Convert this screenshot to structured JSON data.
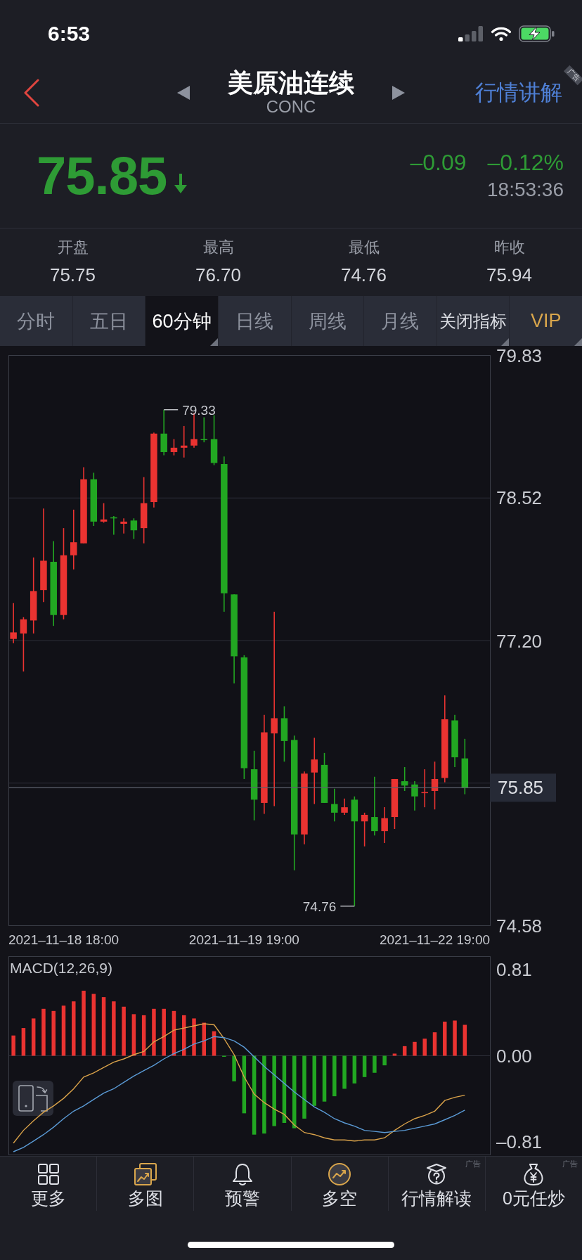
{
  "status_bar": {
    "time": "6:53"
  },
  "header": {
    "title": "美原油连续",
    "subtitle": "CONC",
    "link": "行情讲解",
    "ad_tag": "广告"
  },
  "quote": {
    "price": "75.85",
    "falling": true,
    "change": "–0.09",
    "change_percent": "–0.12%",
    "time": "18:53:36"
  },
  "stats": [
    {
      "label": "开盘",
      "value": "75.75"
    },
    {
      "label": "最高",
      "value": "76.70"
    },
    {
      "label": "最低",
      "value": "74.76"
    },
    {
      "label": "昨收",
      "value": "75.94"
    }
  ],
  "tabs": [
    {
      "label": "分时",
      "kind": "period",
      "selected": false,
      "dropdown": false
    },
    {
      "label": "五日",
      "kind": "period",
      "selected": false,
      "dropdown": false
    },
    {
      "label": "60分钟",
      "kind": "period",
      "selected": true,
      "dropdown": true
    },
    {
      "label": "日线",
      "kind": "period",
      "selected": false,
      "dropdown": false
    },
    {
      "label": "周线",
      "kind": "period",
      "selected": false,
      "dropdown": false
    },
    {
      "label": "月线",
      "kind": "period",
      "selected": false,
      "dropdown": false
    },
    {
      "label": "关闭指标",
      "kind": "indicator",
      "selected": false,
      "dropdown": true
    },
    {
      "label": "VIP",
      "kind": "vip",
      "selected": false,
      "dropdown": true
    }
  ],
  "chart": {
    "chart_data": {
      "type": "candlestick",
      "categories": [
        null,
        null,
        null,
        null,
        null,
        "2021–11–18 18:00",
        null,
        null,
        null,
        null,
        null,
        null,
        null,
        null,
        null,
        null,
        null,
        null,
        null,
        null,
        null,
        null,
        null,
        "2021–11–19 19:00",
        null,
        null,
        null,
        null,
        null,
        null,
        null,
        null,
        null,
        null,
        null,
        null,
        null,
        null,
        null,
        null,
        null,
        null,
        "2021–11–22 19:00",
        null,
        null,
        null,
        null,
        null
      ],
      "ohlc": [
        [
          77.22,
          77.55,
          77.18,
          77.28
        ],
        [
          77.27,
          77.42,
          76.92,
          77.4
        ],
        [
          77.39,
          77.97,
          77.27,
          77.66
        ],
        [
          77.67,
          78.42,
          77.56,
          77.94
        ],
        [
          77.93,
          78.12,
          77.34,
          77.44
        ],
        [
          77.44,
          78.24,
          77.4,
          77.99
        ],
        [
          77.99,
          78.41,
          77.86,
          78.11
        ],
        [
          78.1,
          78.8,
          78.1,
          78.69
        ],
        [
          78.69,
          78.75,
          78.26,
          78.3
        ],
        [
          78.3,
          78.47,
          78.29,
          78.32
        ],
        [
          78.34,
          78.35,
          78.18,
          78.33
        ],
        [
          78.28,
          78.33,
          78.19,
          78.3
        ],
        [
          78.31,
          78.33,
          78.14,
          78.22
        ],
        [
          78.24,
          78.71,
          78.1,
          78.47
        ],
        [
          78.48,
          79.12,
          78.43,
          79.11
        ],
        [
          79.11,
          79.33,
          78.91,
          78.94
        ],
        [
          78.94,
          79.06,
          78.91,
          78.98
        ],
        [
          78.98,
          79.18,
          78.89,
          79.0
        ],
        [
          79.0,
          79.3,
          78.98,
          79.06
        ],
        [
          79.06,
          79.26,
          79.03,
          79.05
        ],
        [
          79.06,
          79.28,
          78.82,
          78.84
        ],
        [
          78.83,
          78.9,
          77.47,
          77.64
        ],
        [
          77.63,
          77.63,
          76.81,
          77.06
        ],
        [
          77.05,
          77.07,
          75.93,
          76.03
        ],
        [
          76.02,
          76.19,
          75.55,
          75.74
        ],
        [
          75.71,
          76.52,
          75.61,
          76.36
        ],
        [
          76.35,
          77.47,
          75.68,
          76.49
        ],
        [
          76.49,
          76.6,
          76.09,
          76.28
        ],
        [
          76.29,
          76.33,
          75.09,
          75.42
        ],
        [
          75.42,
          76.0,
          75.33,
          75.98
        ],
        [
          75.99,
          76.31,
          75.7,
          76.11
        ],
        [
          76.06,
          76.17,
          75.71,
          75.71
        ],
        [
          75.7,
          75.84,
          75.54,
          75.62
        ],
        [
          75.62,
          75.75,
          75.6,
          75.67
        ],
        [
          75.74,
          75.77,
          74.76,
          75.54
        ],
        [
          75.54,
          75.62,
          75.31,
          75.6
        ],
        [
          75.58,
          75.95,
          75.41,
          75.45
        ],
        [
          75.45,
          75.67,
          75.34,
          75.57
        ],
        [
          75.58,
          75.93,
          75.47,
          75.93
        ],
        [
          75.91,
          76.04,
          75.82,
          75.87
        ],
        [
          75.88,
          75.91,
          75.64,
          75.77
        ],
        [
          75.8,
          76.02,
          75.67,
          75.81
        ],
        [
          75.82,
          76.09,
          75.65,
          75.93
        ],
        [
          75.94,
          76.7,
          75.9,
          76.48
        ],
        [
          76.47,
          76.52,
          76.04,
          76.13
        ],
        [
          76.12,
          76.3,
          75.79,
          75.85
        ],
        null,
        null
      ],
      "ylim": [
        74.58,
        79.83
      ],
      "yticks": [
        {
          "value": 79.83,
          "label": "79.83"
        },
        {
          "value": 78.52,
          "label": "78.52"
        },
        {
          "value": 77.2,
          "label": "77.20"
        },
        {
          "value": 74.58,
          "label": "74.58"
        }
      ],
      "ref_lines": [
        {
          "axis": "y",
          "value": 75.85,
          "label": "75.85"
        }
      ],
      "annotations": [
        "79.33",
        "74.76"
      ]
    }
  },
  "macd": {
    "title": "MACD(12,26,9)",
    "histogram": {
      "chart_data": {
        "type": "bar",
        "categories": [
          null,
          null,
          null,
          null,
          null,
          null,
          null,
          null,
          null,
          null,
          null,
          null,
          null,
          null,
          null,
          null,
          null,
          null,
          null,
          null,
          null,
          null,
          null,
          null,
          null,
          null,
          null,
          null,
          null,
          null,
          null,
          null,
          null,
          null,
          null,
          null,
          null,
          null,
          null,
          null,
          null,
          null,
          null,
          null,
          null,
          null,
          null,
          null
        ],
        "ylim": [
          -0.93,
          0.93
        ],
        "yticks": [
          {
            "value": 0.81,
            "label": "0.81"
          },
          {
            "value": 0,
            "label": "0.00"
          },
          {
            "value": -0.81,
            "label": "–0.81"
          }
        ],
        "values": [
          0.19,
          0.26,
          0.35,
          0.44,
          0.42,
          0.47,
          0.51,
          0.61,
          0.58,
          0.55,
          0.51,
          0.46,
          0.39,
          0.38,
          0.44,
          0.44,
          0.42,
          0.38,
          0.35,
          0.31,
          0.23,
          -0.01,
          -0.24,
          -0.54,
          -0.74,
          -0.73,
          -0.66,
          -0.63,
          -0.68,
          -0.59,
          -0.47,
          -0.43,
          -0.38,
          -0.31,
          -0.26,
          -0.2,
          -0.16,
          -0.09,
          0.02,
          0.09,
          0.13,
          0.16,
          0.22,
          0.32,
          0.33,
          0.29,
          null,
          null
        ]
      }
    },
    "lines": {
      "chart_data": {
        "type": "line",
        "categories": [
          null,
          null,
          null,
          null,
          null,
          null,
          null,
          null,
          null,
          null,
          null,
          null,
          null,
          null,
          null,
          null,
          null,
          null,
          null,
          null,
          null,
          null,
          null,
          null,
          null,
          null,
          null,
          null,
          null,
          null,
          null,
          null,
          null,
          null,
          null,
          null,
          null,
          null,
          null,
          null,
          null,
          null,
          null,
          null,
          null,
          null,
          null,
          null
        ],
        "ylim": [
          -0.93,
          0.93
        ],
        "series": [
          {
            "color": "#d9a24a",
            "values": [
              -0.82,
              -0.7,
              -0.61,
              -0.53,
              -0.47,
              -0.4,
              -0.31,
              -0.2,
              -0.16,
              -0.11,
              -0.06,
              -0.03,
              0.01,
              0.04,
              0.13,
              0.18,
              0.24,
              0.26,
              0.28,
              0.3,
              0.29,
              0.16,
              0.01,
              -0.2,
              -0.36,
              -0.44,
              -0.5,
              -0.55,
              -0.65,
              -0.72,
              -0.74,
              -0.77,
              -0.79,
              -0.79,
              -0.8,
              -0.79,
              -0.79,
              -0.77,
              -0.7,
              -0.64,
              -0.59,
              -0.56,
              -0.52,
              -0.42,
              -0.39,
              -0.37,
              null,
              null
            ]
          },
          {
            "color": "#5b9bd6",
            "values": [
              -0.9,
              -0.86,
              -0.8,
              -0.74,
              -0.67,
              -0.59,
              -0.52,
              -0.47,
              -0.41,
              -0.35,
              -0.31,
              -0.25,
              -0.19,
              -0.14,
              -0.09,
              -0.03,
              0.02,
              0.06,
              0.11,
              0.14,
              0.18,
              0.17,
              0.14,
              0.08,
              -0.01,
              -0.1,
              -0.18,
              -0.26,
              -0.34,
              -0.41,
              -0.48,
              -0.53,
              -0.59,
              -0.63,
              -0.66,
              -0.7,
              -0.71,
              -0.72,
              -0.71,
              -0.7,
              -0.68,
              -0.66,
              -0.64,
              -0.6,
              -0.56,
              -0.51,
              null,
              null
            ]
          }
        ]
      }
    }
  },
  "toolbar": [
    {
      "label": "更多"
    },
    {
      "label": "多图"
    },
    {
      "label": "预警"
    },
    {
      "label": "多空"
    },
    {
      "label": "行情解读",
      "ad_tag": "广告"
    },
    {
      "label": "0元任炒",
      "ad_tag": "广告"
    }
  ]
}
